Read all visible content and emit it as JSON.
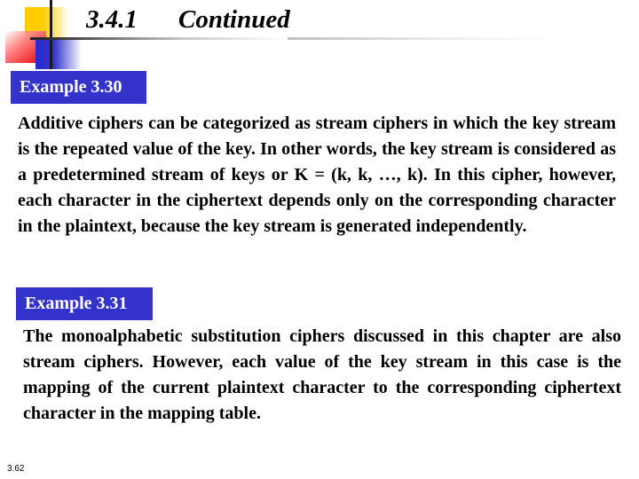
{
  "slide": {
    "section_number": "3.4.1",
    "section_title": "Continued",
    "page_number": "3.62",
    "accent_color": "#3333cc"
  },
  "examples": [
    {
      "label": "Example 3.30",
      "text": "Additive ciphers can be categorized as stream ciphers in which the key stream is the repeated value of the key. In other words, the key stream is considered as a predetermined stream of keys or K = (k, k, …, k). In this cipher, however, each character in the ciphertext depends only on the corresponding character in the plaintext, because the key stream is generated independently."
    },
    {
      "label": "Example 3.31",
      "text": "The monoalphabetic substitution ciphers discussed in this chapter are also stream ciphers. However, each value of the key stream in this case is the mapping of the current plaintext character to the corresponding ciphertext character in the mapping table."
    }
  ]
}
